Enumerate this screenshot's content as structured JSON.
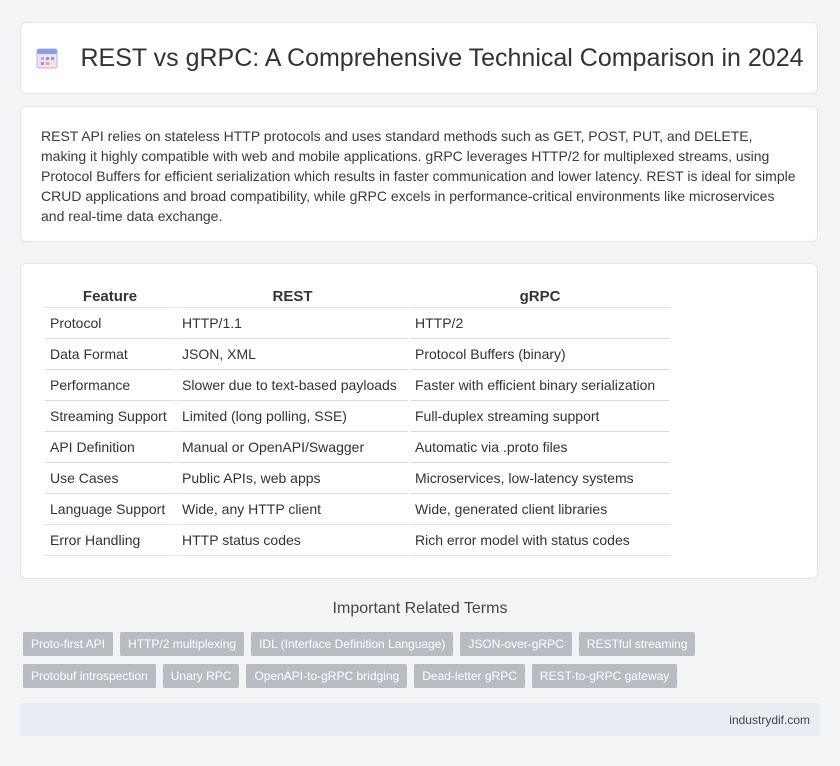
{
  "header": {
    "title": "REST vs gRPC: A Comprehensive Technical Comparison in 2024",
    "icon": "calendar-icon"
  },
  "intro": {
    "text": "REST API relies on stateless HTTP protocols and uses standard methods such as GET, POST, PUT, and DELETE, making it highly compatible with web and mobile applications. gRPC leverages HTTP/2 for multiplexed streams, using Protocol Buffers for efficient serialization which results in faster communication and lower latency. REST is ideal for simple CRUD applications and broad compatibility, while gRPC excels in performance-critical environments like microservices and real-time data exchange."
  },
  "table": {
    "headers": [
      "Feature",
      "REST",
      "gRPC"
    ],
    "rows": [
      [
        "Protocol",
        "HTTP/1.1",
        "HTTP/2"
      ],
      [
        "Data Format",
        "JSON, XML",
        "Protocol Buffers (binary)"
      ],
      [
        "Performance",
        "Slower due to text-based payloads",
        "Faster with efficient binary serialization"
      ],
      [
        "Streaming Support",
        "Limited (long polling, SSE)",
        "Full-duplex streaming support"
      ],
      [
        "API Definition",
        "Manual or OpenAPI/Swagger",
        "Automatic via .proto files"
      ],
      [
        "Use Cases",
        "Public APIs, web apps",
        "Microservices, low-latency systems"
      ],
      [
        "Language Support",
        "Wide, any HTTP client",
        "Wide, generated client libraries"
      ],
      [
        "Error Handling",
        "HTTP status codes",
        "Rich error model with status codes"
      ]
    ]
  },
  "related": {
    "title": "Important Related Terms",
    "tags_row1": [
      "Proto-first API",
      "HTTP/2 multiplexing",
      "IDL (Interface Definition Language)",
      "JSON-over-gRPC",
      "RESTful streaming"
    ],
    "tags_row2": [
      "Protobuf introspection",
      "Unary RPC",
      "OpenAPI-to-gRPC bridging",
      "Dead-letter gRPC",
      "REST-to-gRPC gateway"
    ]
  },
  "footer": {
    "site": "industrydif.com"
  }
}
